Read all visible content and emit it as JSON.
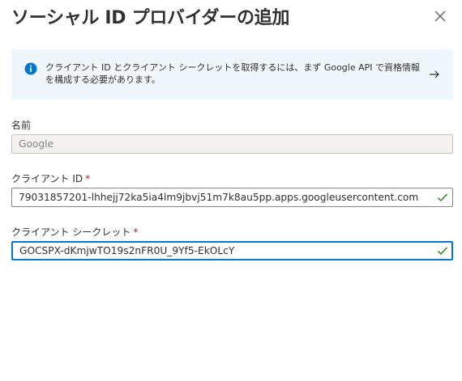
{
  "dialog": {
    "title": "ソーシャル ID プロバイダーの追加",
    "close_icon": "close-icon"
  },
  "info": {
    "icon": "info-icon",
    "text": "クライアント ID とクライアント シークレットを取得するには、まず Google API で資格情報を構成する必要があります。",
    "arrow_icon": "arrow-right-icon"
  },
  "fields": {
    "name": {
      "label": "名前",
      "value": "Google",
      "disabled": true
    },
    "client_id": {
      "label": "クライアント ID",
      "required_mark": "*",
      "value": "79031857201-lhhejj72ka5ia4lm9jbvj51m7k8au5pp.apps.googleusercontent.com",
      "valid_icon": "checkmark-icon"
    },
    "client_secret": {
      "label": "クライアント シークレット",
      "required_mark": "*",
      "value": "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",
      "valid_icon": "checkmark-icon"
    }
  },
  "colors": {
    "accent": "#0078d4",
    "required": "#a4262c",
    "valid": "#107c10",
    "info_background": "#eff6fc"
  }
}
